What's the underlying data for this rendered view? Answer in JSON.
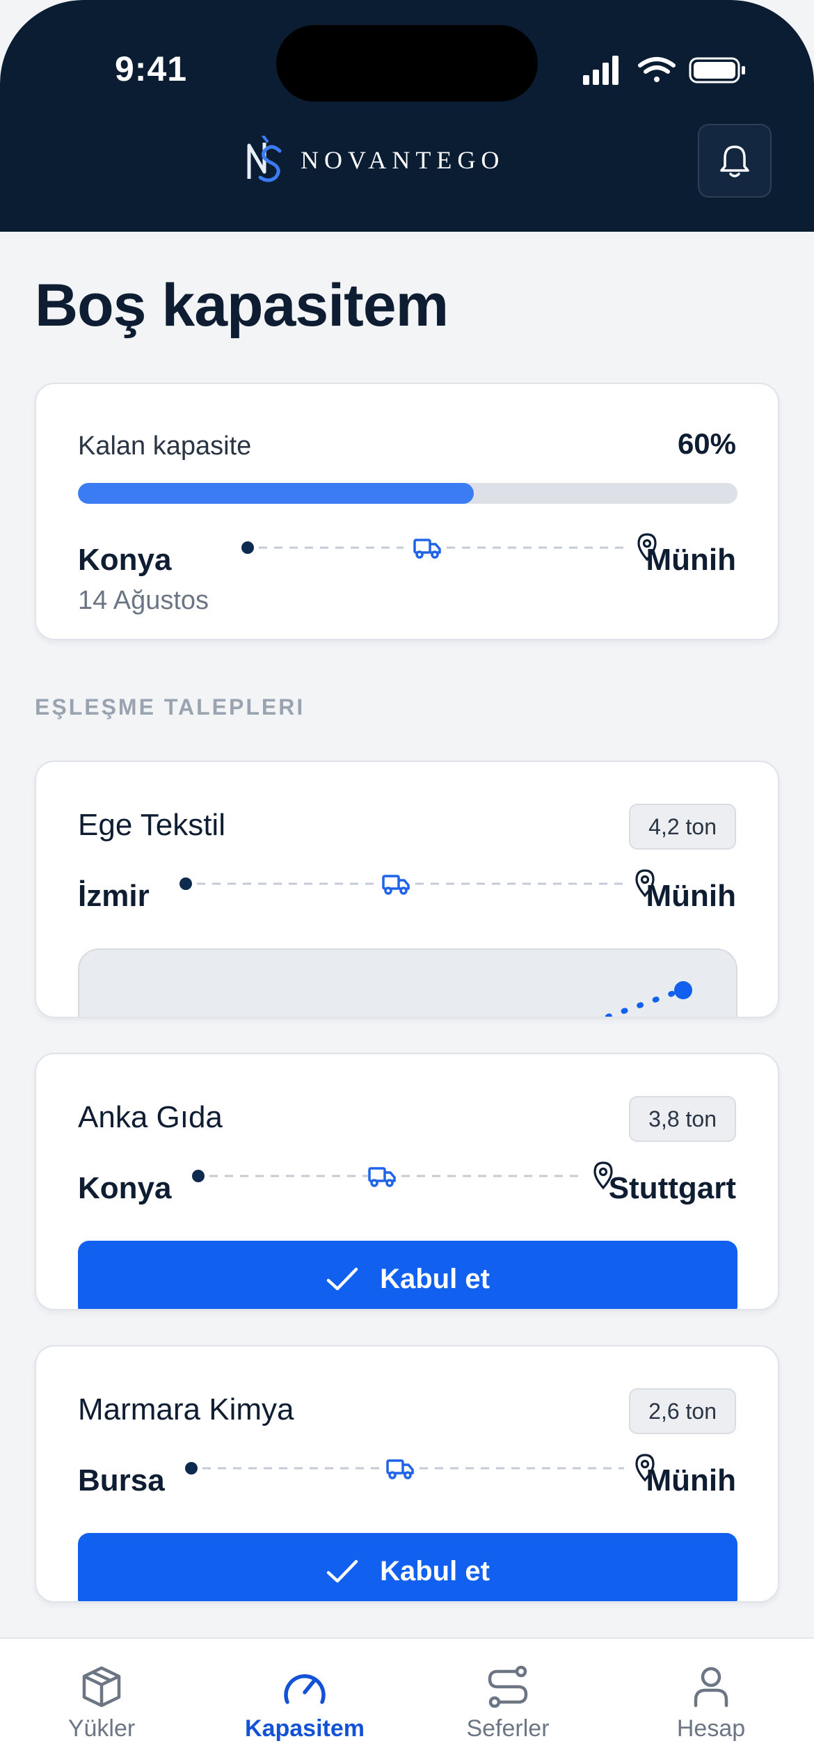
{
  "status_bar": {
    "time": "9:41"
  },
  "header": {
    "brand": "NOVANTEGO"
  },
  "page": {
    "title": "Boş kapasitem"
  },
  "capacity": {
    "label": "Kalan kapasite",
    "percent_text": "60%",
    "remaining_fraction": 0.6,
    "origin": "Konya",
    "date": "14 Ağustos",
    "destination": "Münih"
  },
  "requests_section": {
    "label": "EŞLEŞME TALEPLERI",
    "items": [
      {
        "company": "Ege Tekstil",
        "weight": "4,2 ton",
        "origin": "İzmir",
        "destination": "Münih"
      },
      {
        "company": "Anka Gıda",
        "weight": "3,8 ton",
        "origin": "Konya",
        "destination": "Stuttgart",
        "action": "Kabul et"
      },
      {
        "company": "Marmara Kimya",
        "weight": "2,6 ton",
        "origin": "Bursa",
        "destination": "Münih",
        "action": "Kabul et"
      }
    ]
  },
  "tabbar": {
    "items": [
      {
        "label": "Yükler",
        "icon": "box-icon"
      },
      {
        "label": "Kapasitem",
        "icon": "gauge-icon",
        "active": true
      },
      {
        "label": "Seferler",
        "icon": "route-icon"
      },
      {
        "label": "Hesap",
        "icon": "user-icon"
      }
    ]
  },
  "colors": {
    "header_bg": "#0b1d33",
    "accent": "#1260f0",
    "progress": "#3b7cf5",
    "active_tab": "#1352d6"
  }
}
